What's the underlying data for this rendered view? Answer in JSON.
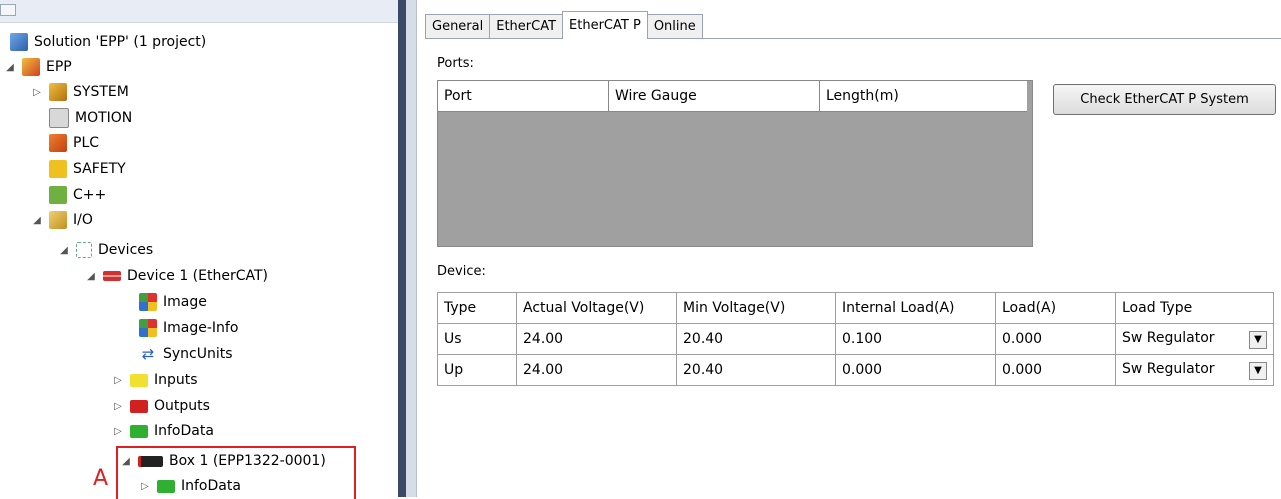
{
  "tree": {
    "solution": "Solution 'EPP' (1 project)",
    "project": "EPP",
    "items": {
      "system": "SYSTEM",
      "motion": "MOTION",
      "plc": "PLC",
      "safety": "SAFETY",
      "cpp": "C++",
      "io": "I/O",
      "devices": "Devices",
      "device1": "Device 1 (EtherCAT)",
      "image": "Image",
      "image_info": "Image-Info",
      "syncunits": "SyncUnits",
      "inputs": "Inputs",
      "outputs": "Outputs",
      "infodata": "InfoData",
      "box1": "Box 1 (EPP1322-0001)",
      "box_infodata": "InfoData"
    }
  },
  "annotation": "A",
  "tabs": [
    "General",
    "EtherCAT",
    "EtherCAT P",
    "Online"
  ],
  "ports": {
    "label": "Ports:",
    "columns": [
      "Port",
      "Wire Gauge",
      "Length(m)"
    ]
  },
  "check_button": "Check EtherCAT P System",
  "device": {
    "label": "Device:",
    "columns": [
      "Type",
      "Actual Voltage(V)",
      "Min Voltage(V)",
      "Internal Load(A)",
      "Load(A)",
      "Load Type"
    ],
    "rows": [
      [
        "Us",
        "24.00",
        "20.40",
        "0.100",
        "0.000",
        "Sw Regulator"
      ],
      [
        "Up",
        "24.00",
        "20.40",
        "0.000",
        "0.000",
        "Sw Regulator"
      ]
    ]
  },
  "colors": {
    "annotation": "#e02020",
    "splitter": "#3a4a66",
    "grid_bg": "#a0a0a0"
  }
}
